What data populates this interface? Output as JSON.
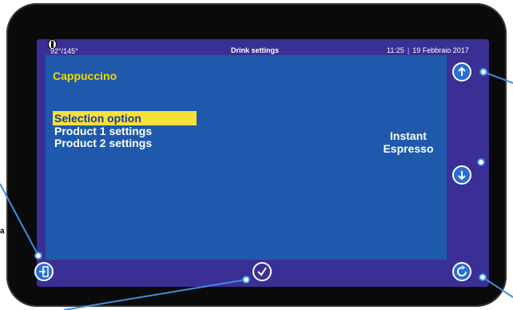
{
  "status": {
    "temperature": "92°/145°",
    "title": "Drink settings",
    "time": "11:25",
    "date": "19 Febbraio 2017"
  },
  "screen": {
    "heading": "Cappuccino",
    "menu": [
      {
        "label": "Selection option",
        "selected": true
      },
      {
        "label": "Product 1 settings",
        "selected": false
      },
      {
        "label": "Product 2 settings",
        "selected": false
      }
    ],
    "values": [
      "Instant",
      "Espresso"
    ]
  },
  "icons": {
    "status": "thermometer-icon",
    "up": "arrow-up-icon",
    "down": "arrow-down-icon",
    "exit": "exit-icon",
    "confirm": "checkmark-icon",
    "home": "home-icon"
  },
  "colors": {
    "device": "#0a0a0a",
    "frame": "#3a2f95",
    "panel": "#1f59ab",
    "heading": "#f1d800",
    "selection": "#f4e23a",
    "callout": "#3d8fe0"
  },
  "margin_letter": "a"
}
